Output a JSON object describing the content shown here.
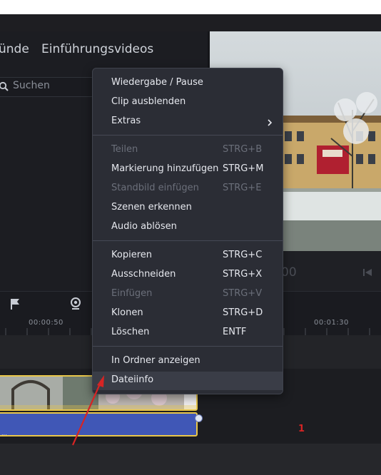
{
  "nav": {
    "tabs": [
      "ünde",
      "Einführungsvideos"
    ]
  },
  "search": {
    "placeholder": "Suchen"
  },
  "player": {
    "time_fragment": "00"
  },
  "timeline": {
    "tick_labels": [
      "00:00:50",
      "00:01:30"
    ],
    "audio_clip_label": "...",
    "marker_number": "1"
  },
  "context_menu": {
    "items": [
      {
        "label": "Wiedergabe / Pause",
        "shortcut": "",
        "disabled": false,
        "submenu": false
      },
      {
        "label": "Clip ausblenden",
        "shortcut": "",
        "disabled": false,
        "submenu": false
      },
      {
        "label": "Extras",
        "shortcut": "",
        "disabled": false,
        "submenu": true
      },
      {
        "label": "Teilen",
        "shortcut": "STRG+B",
        "disabled": true,
        "submenu": false
      },
      {
        "label": "Markierung hinzufügen",
        "shortcut": "STRG+M",
        "disabled": false,
        "submenu": false
      },
      {
        "label": "Standbild einfügen",
        "shortcut": "STRG+E",
        "disabled": true,
        "submenu": false
      },
      {
        "label": "Szenen erkennen",
        "shortcut": "",
        "disabled": false,
        "submenu": false
      },
      {
        "label": "Audio ablösen",
        "shortcut": "",
        "disabled": false,
        "submenu": false
      },
      {
        "label": "Kopieren",
        "shortcut": "STRG+C",
        "disabled": false,
        "submenu": false
      },
      {
        "label": "Ausschneiden",
        "shortcut": "STRG+X",
        "disabled": false,
        "submenu": false
      },
      {
        "label": "Einfügen",
        "shortcut": "STRG+V",
        "disabled": true,
        "submenu": false
      },
      {
        "label": "Klonen",
        "shortcut": "STRG+D",
        "disabled": false,
        "submenu": false
      },
      {
        "label": "Löschen",
        "shortcut": "ENTF",
        "disabled": false,
        "submenu": false
      },
      {
        "label": "In Ordner anzeigen",
        "shortcut": "",
        "disabled": false,
        "submenu": false
      },
      {
        "label": "Dateiinfo",
        "shortcut": "",
        "disabled": false,
        "submenu": false
      }
    ]
  },
  "icons": {
    "search": "search-icon",
    "flag": "flag-icon",
    "webcam": "webcam-icon",
    "submenu": "chevron-right-icon",
    "skip_back": "skip-back-icon"
  },
  "colors": {
    "menu_bg": "#2b2d35",
    "menu_hover": "#3a3d47",
    "clip_border": "#e8c64a",
    "audio_clip": "#4057b6",
    "annotation_red": "#d62424"
  }
}
